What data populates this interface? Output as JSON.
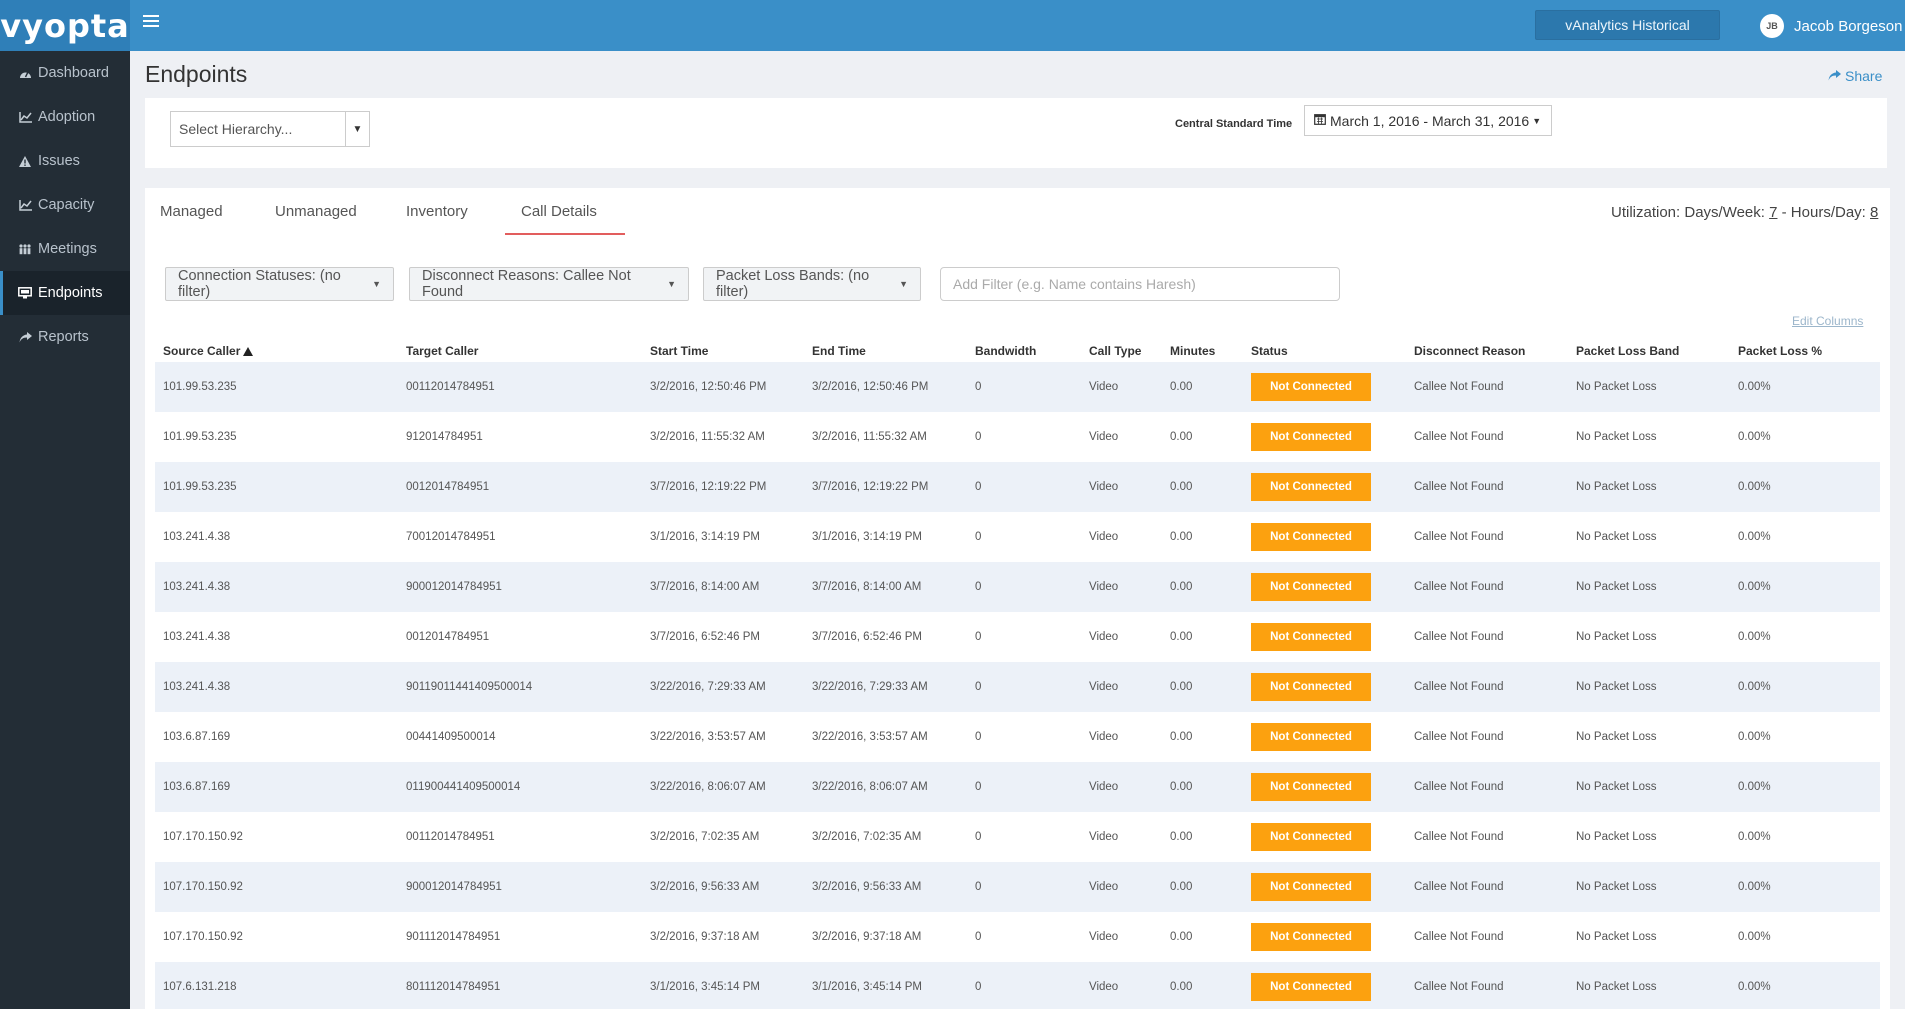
{
  "brand": {
    "logo": "vyopta"
  },
  "topbar": {
    "vanalytics": "vAnalytics Historical",
    "user_initials": "JB",
    "user_name": "Jacob Borgeson"
  },
  "sidebar": {
    "items": [
      {
        "label": "Dashboard",
        "icon": "dashboard-icon"
      },
      {
        "label": "Adoption",
        "icon": "line-chart-icon"
      },
      {
        "label": "Issues",
        "icon": "warning-icon"
      },
      {
        "label": "Capacity",
        "icon": "line-chart-icon"
      },
      {
        "label": "Meetings",
        "icon": "people-icon"
      },
      {
        "label": "Endpoints",
        "icon": "monitor-icon",
        "active": true
      },
      {
        "label": "Reports",
        "icon": "share-icon"
      }
    ]
  },
  "page": {
    "title": "Endpoints",
    "share": "Share"
  },
  "filters": {
    "hierarchy_placeholder": "Select Hierarchy...",
    "timezone": "Central Standard Time",
    "date_range": "March 1, 2016 - March 31, 2016"
  },
  "tabs": [
    "Managed",
    "Unmanaged",
    "Inventory",
    "Call Details"
  ],
  "active_tab": "Call Details",
  "utilization": {
    "prefix": "Utilization: Days/Week:",
    "days": "7",
    "mid": "- Hours/Day:",
    "hours": "8"
  },
  "filter_buttons": {
    "connection": "Connection Statuses: (no filter)",
    "disconnect": "Disconnect Reasons: Callee Not Found",
    "packet_loss": "Packet Loss Bands: (no filter)"
  },
  "add_filter_placeholder": "Add Filter (e.g. Name contains Haresh)",
  "edit_columns": "Edit Columns",
  "columns": [
    "Source Caller",
    "Target Caller",
    "Start Time",
    "End Time",
    "Bandwidth",
    "Call Type",
    "Minutes",
    "Status",
    "Disconnect Reason",
    "Packet Loss Band",
    "Packet Loss %"
  ],
  "rows": [
    [
      "101.99.53.235",
      "00112014784951",
      "3/2/2016, 12:50:46 PM",
      "3/2/2016, 12:50:46 PM",
      "0",
      "Video",
      "0.00",
      "Not Connected",
      "Callee Not Found",
      "No Packet Loss",
      "0.00%"
    ],
    [
      "101.99.53.235",
      "912014784951",
      "3/2/2016, 11:55:32 AM",
      "3/2/2016, 11:55:32 AM",
      "0",
      "Video",
      "0.00",
      "Not Connected",
      "Callee Not Found",
      "No Packet Loss",
      "0.00%"
    ],
    [
      "101.99.53.235",
      "0012014784951",
      "3/7/2016, 12:19:22 PM",
      "3/7/2016, 12:19:22 PM",
      "0",
      "Video",
      "0.00",
      "Not Connected",
      "Callee Not Found",
      "No Packet Loss",
      "0.00%"
    ],
    [
      "103.241.4.38",
      "70012014784951",
      "3/1/2016, 3:14:19 PM",
      "3/1/2016, 3:14:19 PM",
      "0",
      "Video",
      "0.00",
      "Not Connected",
      "Callee Not Found",
      "No Packet Loss",
      "0.00%"
    ],
    [
      "103.241.4.38",
      "900012014784951",
      "3/7/2016, 8:14:00 AM",
      "3/7/2016, 8:14:00 AM",
      "0",
      "Video",
      "0.00",
      "Not Connected",
      "Callee Not Found",
      "No Packet Loss",
      "0.00%"
    ],
    [
      "103.241.4.38",
      "0012014784951",
      "3/7/2016, 6:52:46 PM",
      "3/7/2016, 6:52:46 PM",
      "0",
      "Video",
      "0.00",
      "Not Connected",
      "Callee Not Found",
      "No Packet Loss",
      "0.00%"
    ],
    [
      "103.241.4.38",
      "90119011441409500014",
      "3/22/2016, 7:29:33 AM",
      "3/22/2016, 7:29:33 AM",
      "0",
      "Video",
      "0.00",
      "Not Connected",
      "Callee Not Found",
      "No Packet Loss",
      "0.00%"
    ],
    [
      "103.6.87.169",
      "00441409500014",
      "3/22/2016, 3:53:57 AM",
      "3/22/2016, 3:53:57 AM",
      "0",
      "Video",
      "0.00",
      "Not Connected",
      "Callee Not Found",
      "No Packet Loss",
      "0.00%"
    ],
    [
      "103.6.87.169",
      "011900441409500014",
      "3/22/2016, 8:06:07 AM",
      "3/22/2016, 8:06:07 AM",
      "0",
      "Video",
      "0.00",
      "Not Connected",
      "Callee Not Found",
      "No Packet Loss",
      "0.00%"
    ],
    [
      "107.170.150.92",
      "00112014784951",
      "3/2/2016, 7:02:35 AM",
      "3/2/2016, 7:02:35 AM",
      "0",
      "Video",
      "0.00",
      "Not Connected",
      "Callee Not Found",
      "No Packet Loss",
      "0.00%"
    ],
    [
      "107.170.150.92",
      "900012014784951",
      "3/2/2016, 9:56:33 AM",
      "3/2/2016, 9:56:33 AM",
      "0",
      "Video",
      "0.00",
      "Not Connected",
      "Callee Not Found",
      "No Packet Loss",
      "0.00%"
    ],
    [
      "107.170.150.92",
      "901112014784951",
      "3/2/2016, 9:37:18 AM",
      "3/2/2016, 9:37:18 AM",
      "0",
      "Video",
      "0.00",
      "Not Connected",
      "Callee Not Found",
      "No Packet Loss",
      "0.00%"
    ],
    [
      "107.6.131.218",
      "801112014784951",
      "3/1/2016, 3:45:14 PM",
      "3/1/2016, 3:45:14 PM",
      "0",
      "Video",
      "0.00",
      "Not Connected",
      "Callee Not Found",
      "No Packet Loss",
      "0.00%"
    ]
  ],
  "colors": {
    "topbar": "#3a8fc8",
    "sidebar": "#232d36",
    "status_badge": "#fca10f",
    "tab_underline": "#e25d5d"
  }
}
